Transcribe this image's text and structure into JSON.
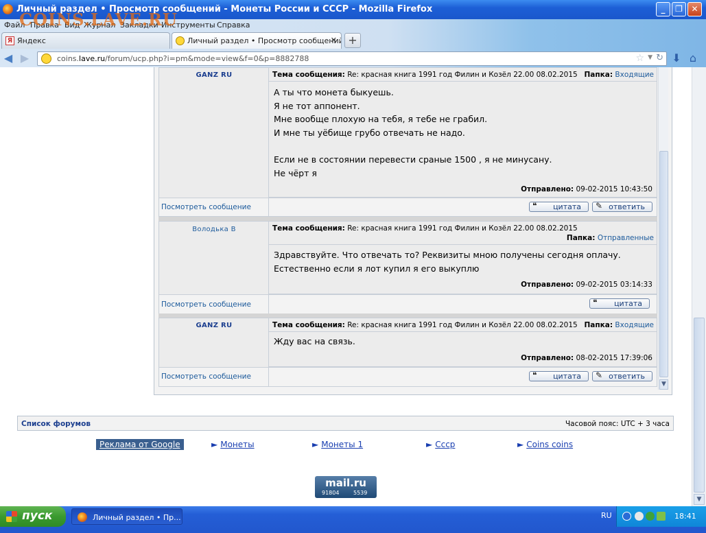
{
  "window": {
    "title": "Личный раздел • Просмотр сообщений - Монеты России и СССР - Mozilla Firefox",
    "watermark": "COINS.LAVE.RU"
  },
  "menu": [
    "Файл",
    "Правка",
    "Вид",
    "Журнал",
    "Закладки",
    "Инструменты",
    "Справка"
  ],
  "tabs": [
    {
      "label": "Яндекс",
      "active": false
    },
    {
      "label": "Личный раздел • Просмотр сообщений...",
      "active": true
    }
  ],
  "url": {
    "prefix": "coins.",
    "domain": "lave.ru",
    "path": "/forum/ucp.php?i=pm&mode=view&f=0&p=8882788"
  },
  "posts": [
    {
      "author": "GANZ RU",
      "author_style": "bold",
      "subject_label": "Тема сообщения:",
      "subject": "Re: красная книга 1991 год Филин и Козёл 22.00 08.02.2015",
      "folder_label": "Папка:",
      "folder": "Входящие",
      "message": "А ты что монета быкуешь.\nЯ не тот аппонент.\nМне вообще плохую на тебя, я тебе не грабил.\nИ мне ты уёбище грубо отвечать не надо.\n\nЕсли не в состоянии перевести сраные 1500 , я не минусану.\nНе чёрт я",
      "sent_label": "Отправлено:",
      "sent": "09-02-2015 10:43:50",
      "view_link": "Посмотреть сообщение",
      "buttons": [
        "цитата",
        "ответить"
      ]
    },
    {
      "author": "Володька В",
      "author_style": "normal",
      "subject_label": "Тема сообщения:",
      "subject": "Re: красная книга 1991 год Филин и Козёл 22.00 08.02.2015",
      "folder_label": "Папка:",
      "folder": "Отправленные",
      "message": "Здравствуйте. Что отвечать то? Реквизиты мною получены сегодня оплачу.\nЕстественно если я лот купил я его выкуплю",
      "sent_label": "Отправлено:",
      "sent": "09-02-2015 03:14:33",
      "view_link": "Посмотреть сообщение",
      "buttons": [
        "цитата"
      ]
    },
    {
      "author": "GANZ RU",
      "author_style": "bold",
      "subject_label": "Тема сообщения:",
      "subject": "Re: красная книга 1991 год Филин и Козёл 22.00 08.02.2015",
      "folder_label": "Папка:",
      "folder": "Входящие",
      "message": "Жду вас на связь.",
      "sent_label": "Отправлено:",
      "sent": "08-02-2015 17:39:06",
      "view_link": "Посмотреть сообщение",
      "buttons": [
        "цитата",
        "ответить"
      ]
    }
  ],
  "footer": {
    "forum_list": "Список форумов",
    "timezone": "Часовой пояс: UTC + 3 часа"
  },
  "ads": {
    "google": "Реклама от Google",
    "links": [
      "Монеты",
      "Монеты 1",
      "Ссср",
      "Coins coins"
    ]
  },
  "mailru": {
    "logo": "mail.ru",
    "count1": "91804",
    "count2": "5539"
  },
  "taskbar": {
    "start": "пуск",
    "task": "Личный раздел • Пр...",
    "lang": "RU",
    "clock": "18:41"
  }
}
